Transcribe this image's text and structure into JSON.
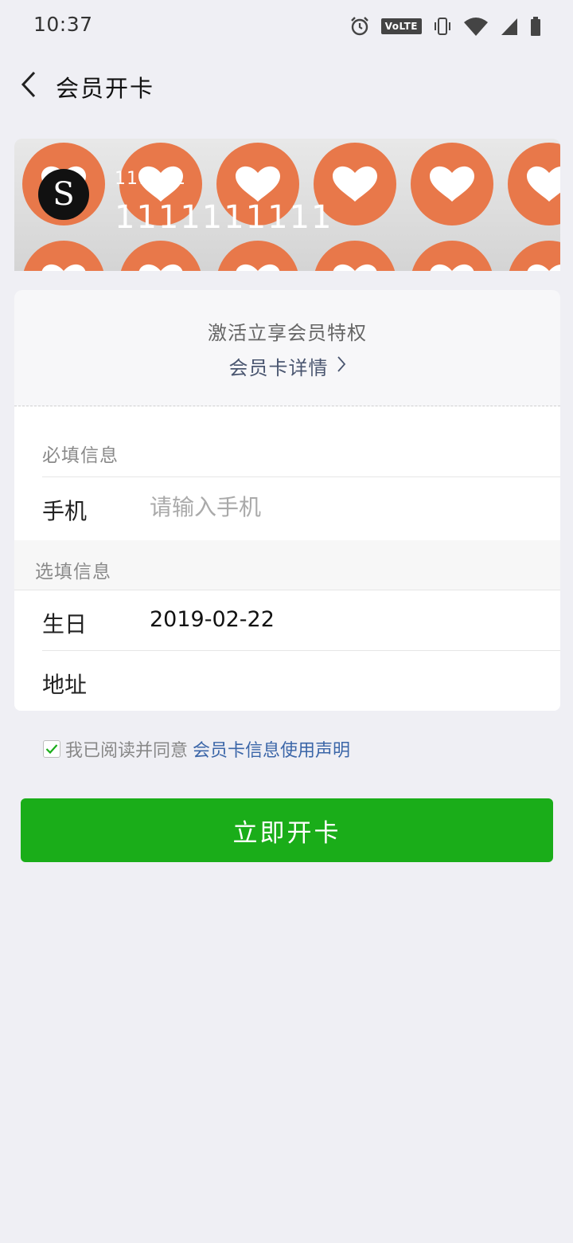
{
  "status_bar": {
    "time": "10:37",
    "volte_label": "VoLTE",
    "icons": [
      "alarm-icon",
      "volte-icon",
      "vibrate-icon",
      "wifi-icon",
      "signal-icon",
      "battery-icon"
    ]
  },
  "nav": {
    "back_icon": "chevron-left-icon",
    "title": "会员开卡"
  },
  "card": {
    "avatar_letter": "S",
    "subtitle": "111111",
    "number": "1111111111",
    "pattern_color": "#e8784a",
    "pattern_icon": "heart-icon"
  },
  "info": {
    "slogan": "激活立享会员特权",
    "detail_link": "会员卡详情"
  },
  "form": {
    "required_label": "必填信息",
    "phone_label": "手机",
    "phone_placeholder": "请输入手机",
    "optional_label": "选填信息",
    "birthday_label": "生日",
    "birthday_value": "2019-02-22",
    "address_label": "地址"
  },
  "agreement": {
    "checked": true,
    "text": "我已阅读并同意",
    "link": "会员卡信息使用声明"
  },
  "button": {
    "label": "立即开卡",
    "color": "#1aad19"
  }
}
